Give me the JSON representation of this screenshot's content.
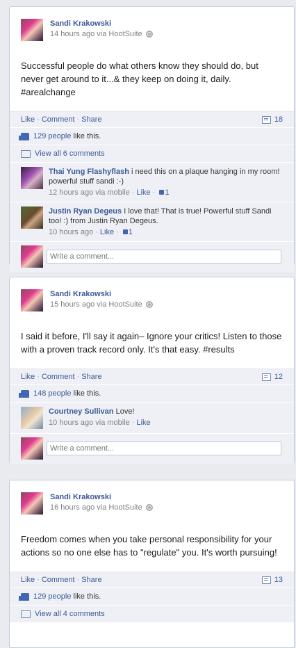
{
  "posts": [
    {
      "author": "Sandi Krakowski",
      "meta": "14 hours ago via HootSuite",
      "text": "Successful people do what others know they should do, but never get around to it...& they keep on doing it, daily. #arealchange",
      "actions": {
        "like": "Like",
        "comment": "Comment",
        "share": "Share"
      },
      "comment_count": "18",
      "likes_link": "129 people",
      "likes_suffix": "like this.",
      "view_all": "View all 6 comments",
      "comments": [
        {
          "name": "Thai Yung Flashyflash",
          "text": "i need this on a plaque hanging in my room! powerful stuff sandi :-)",
          "meta": "12 hours ago via mobile",
          "like": "Like",
          "like_count": "1"
        },
        {
          "name": "Justin Ryan Degeus",
          "text": "I love that! That is true! Powerful stuff Sandi too! :) from Justin Ryan Degeus.",
          "meta": "10 hours ago",
          "like": "Like",
          "like_count": "1"
        }
      ],
      "write_placeholder": "Write a comment..."
    },
    {
      "author": "Sandi Krakowski",
      "meta": "15 hours ago via HootSuite",
      "text": "I said it before, I'll say it again– Ignore your critics! Listen to those with a proven track record only. It's that easy. #results",
      "actions": {
        "like": "Like",
        "comment": "Comment",
        "share": "Share"
      },
      "comment_count": "12",
      "likes_link": "148 people",
      "likes_suffix": "like this.",
      "comments": [
        {
          "name": "Courtney Sullivan",
          "text": "Love!",
          "meta": "10 hours ago via mobile",
          "like": "Like"
        }
      ],
      "write_placeholder": "Write a comment..."
    },
    {
      "author": "Sandi Krakowski",
      "meta": "16 hours ago via HootSuite",
      "text": "Freedom comes when you take personal responsibility for your actions so no one else has to \"regulate\" you. It's worth pursuing!",
      "actions": {
        "like": "Like",
        "comment": "Comment",
        "share": "Share"
      },
      "comment_count": "13",
      "likes_link": "129 people",
      "likes_suffix": "like this.",
      "view_all": "View all 4 comments"
    }
  ]
}
